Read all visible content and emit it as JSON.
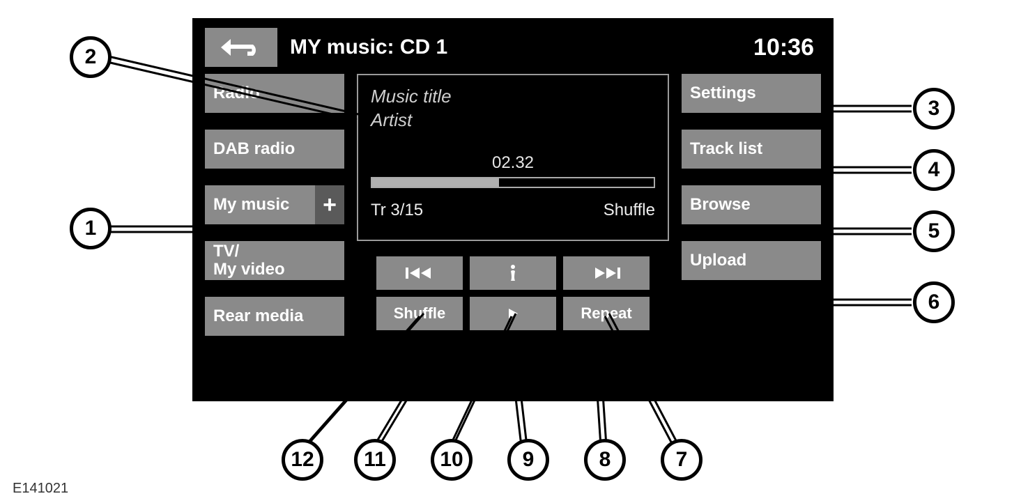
{
  "header": {
    "title": "MY music: CD 1",
    "clock": "10:36"
  },
  "left_menu": {
    "radio": "Radio",
    "dab": "DAB radio",
    "mymusic": "My music",
    "mymusic_plus": "+",
    "tv": "TV/\nMy video",
    "rear": "Rear media"
  },
  "right_menu": {
    "settings": "Settings",
    "tracklist": "Track list",
    "browse": "Browse",
    "upload": "Upload"
  },
  "info": {
    "music_title": "Music title",
    "artist": "Artist",
    "elapsed": "02.32",
    "progress_percent": 45,
    "track_counter": "Tr 3/15",
    "mode": "Shuffle"
  },
  "controls": {
    "shuffle": "Shuffle",
    "repeat": "Repeat"
  },
  "callouts": {
    "1": "1",
    "2": "2",
    "3": "3",
    "4": "4",
    "5": "5",
    "6": "6",
    "7": "7",
    "8": "8",
    "9": "9",
    "10": "10",
    "11": "11",
    "12": "12"
  },
  "figure_id": "E141021"
}
